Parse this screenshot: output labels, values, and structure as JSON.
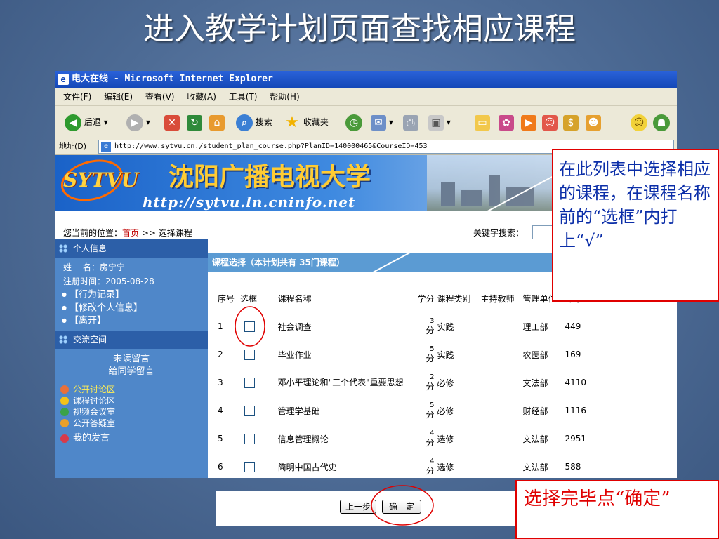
{
  "slide_title": "进入教学计划页面查找相应课程",
  "window": {
    "title": "电大在线 - Microsoft Internet Explorer",
    "menu": [
      "文件(F)",
      "编辑(E)",
      "查看(V)",
      "收藏(A)",
      "工具(T)",
      "帮助(H)"
    ],
    "toolbar": {
      "back": "后退",
      "search": "搜索",
      "favorites": "收藏夹"
    },
    "address_label": "地址(D)",
    "url": "http://www.sytvu.cn./student_plan_course.php?PlanID=140000465&CourseID=453"
  },
  "banner": {
    "logo": "SYTVU",
    "name": "沈阳广播电视大学",
    "url": "http://sytvu.ln.cninfo.net"
  },
  "breadcrumb": {
    "prefix": "您当前的位置：",
    "home": "首页",
    "separator": " >> ",
    "current": "选择课程"
  },
  "keyword_label": "关键字搜索：",
  "sidebar": {
    "personal_header": "个人信息",
    "name_line": "姓　 名：房宁宁",
    "register_line": "注册时间：2005-08-28",
    "links": [
      "【行为记录】",
      "【修改个人信息】",
      "【离开】"
    ],
    "exchange_header": "交流空间",
    "unread": "未读留言",
    "leave_msg": "给同学留言",
    "forums": [
      "公开讨论区",
      "课程讨论区",
      "视频会议室",
      "公开答疑室"
    ],
    "my_posts": "我的发言"
  },
  "course_table": {
    "caption": "课程选择（本计划共有 35门课程）",
    "headers": [
      "序号",
      "选框",
      "课程名称",
      "学分",
      "课程类别",
      "主持教师",
      "管理单位",
      "课号"
    ],
    "rows": [
      {
        "no": "1",
        "name": "社会调查",
        "credit": "3",
        "unit_label": "分",
        "type": "实践",
        "teacher": "",
        "dept": "理工部",
        "code": "449"
      },
      {
        "no": "2",
        "name": "毕业作业",
        "credit": "5",
        "unit_label": "分",
        "type": "实践",
        "teacher": "",
        "dept": "农医部",
        "code": "169"
      },
      {
        "no": "3",
        "name": "邓小平理论和\"三个代表\"重要思想",
        "credit": "2",
        "unit_label": "分",
        "type": "必修",
        "teacher": "",
        "dept": "文法部",
        "code": "4110"
      },
      {
        "no": "4",
        "name": "管理学基础",
        "credit": "5",
        "unit_label": "分",
        "type": "必修",
        "teacher": "",
        "dept": "财经部",
        "code": "1116"
      },
      {
        "no": "5",
        "name": "信息管理概论",
        "credit": "4",
        "unit_label": "分",
        "type": "选修",
        "teacher": "",
        "dept": "文法部",
        "code": "2951"
      },
      {
        "no": "6",
        "name": "简明中国古代史",
        "credit": "4",
        "unit_label": "分",
        "type": "选修",
        "teacher": "",
        "dept": "文法部",
        "code": "588"
      }
    ]
  },
  "buttons": {
    "prev": "上一步",
    "confirm": "确　定"
  },
  "callouts": {
    "select": "在此列表中选择相应的课程，在课程名称前的“选框”内打上“√”",
    "confirm": "选择完毕点“确定”"
  },
  "colors": {
    "slide_bg": "#4d6b95",
    "callout_border": "#e00000",
    "callout1_text": "#0b2ea8",
    "sidebar": "#4f87c9"
  }
}
